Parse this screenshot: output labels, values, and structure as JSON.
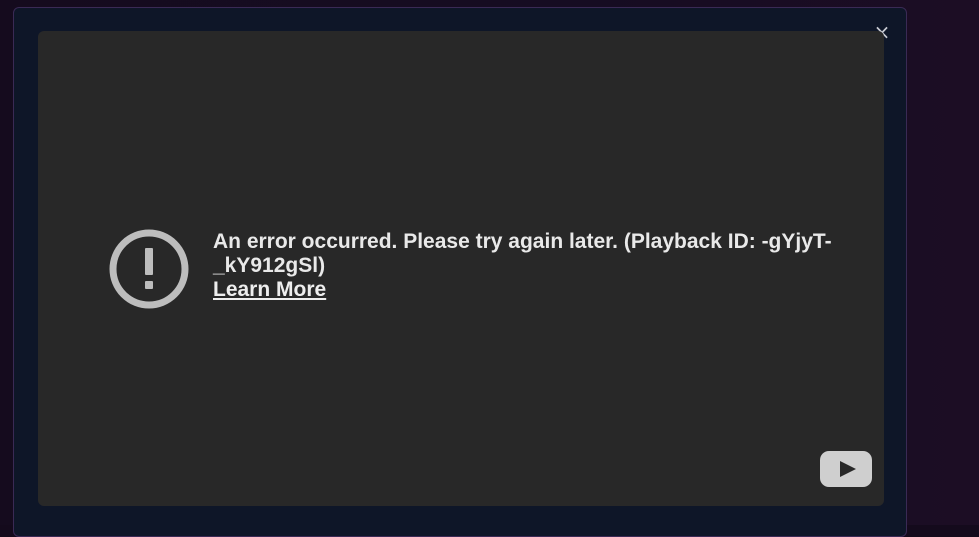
{
  "modal": {
    "close_label": "×"
  },
  "player": {
    "error_message": "An error occurred. Please try again later. (Playback ID: -gYjyT-_kY912gSl)",
    "learn_more_label": "Learn More",
    "error_icon": "exclamation-circle-icon",
    "logo_icon": "youtube-logo-icon"
  },
  "colors": {
    "player_bg": "#282828",
    "modal_bg": "#0e1628",
    "icon_gray": "#bdbdbd"
  }
}
